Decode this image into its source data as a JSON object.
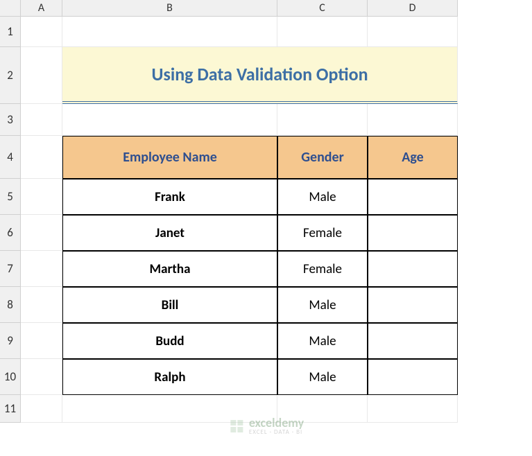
{
  "columns": [
    "A",
    "B",
    "C",
    "D"
  ],
  "rows": [
    "1",
    "2",
    "3",
    "4",
    "5",
    "6",
    "7",
    "8",
    "9",
    "10",
    "11"
  ],
  "title": "Using Data Validation Option",
  "table": {
    "headers": [
      "Employee Name",
      "Gender",
      "Age"
    ],
    "data": [
      {
        "name": "Frank",
        "gender": "Male",
        "age": ""
      },
      {
        "name": "Janet",
        "gender": "Female",
        "age": ""
      },
      {
        "name": "Martha",
        "gender": "Female",
        "age": ""
      },
      {
        "name": "Bill",
        "gender": "Male",
        "age": ""
      },
      {
        "name": "Budd",
        "gender": "Male",
        "age": ""
      },
      {
        "name": "Ralph",
        "gender": "Male",
        "age": ""
      }
    ]
  },
  "watermark": {
    "brand": "exceldemy",
    "tagline": "EXCEL · DATA · BI"
  }
}
